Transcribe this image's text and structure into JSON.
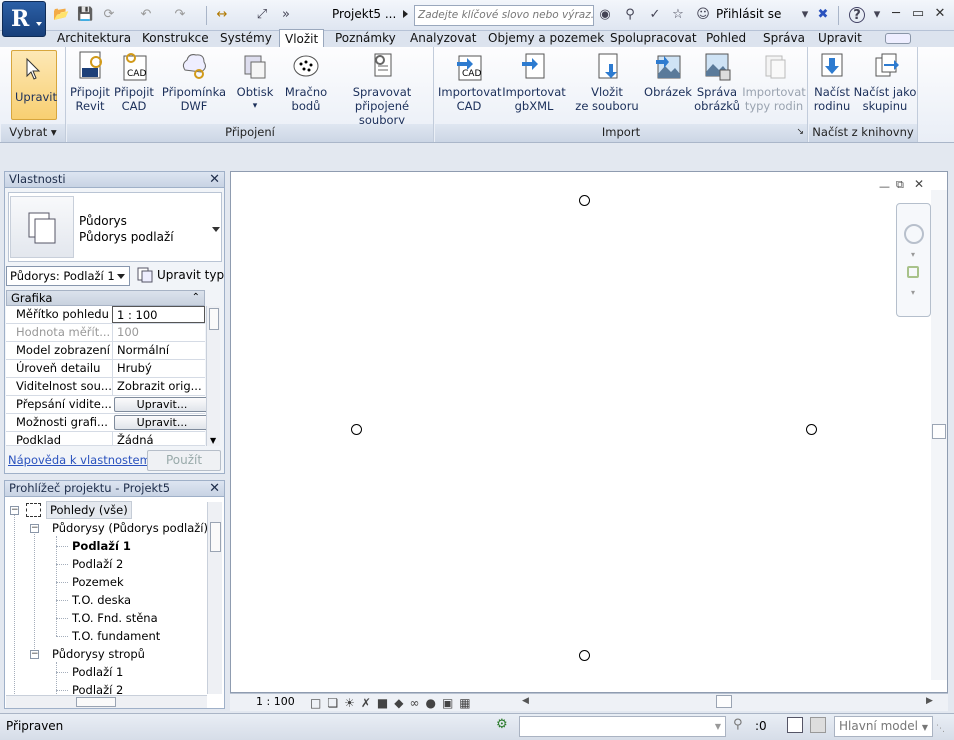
{
  "titlebar": {
    "app_logo": "R",
    "doc_title": "Projekt5 ...",
    "search_placeholder": "Zadejte klíčové slovo nebo výraz.",
    "sign_in": "Přihlásit se"
  },
  "tabs": [
    "Architektura",
    "Konstrukce",
    "Systémy",
    "Vložit",
    "Poznámky",
    "Analyzovat",
    "Objemy a pozemek",
    "Spolupracovat",
    "Pohled",
    "Správa",
    "Upravit"
  ],
  "active_tab": "Vložit",
  "ribbon": {
    "modify": {
      "label": "Upravit",
      "panel": "Vybrat"
    },
    "link_panel": {
      "label": "Připojení",
      "buttons": [
        {
          "line1": "Připojit",
          "line2": "Revit"
        },
        {
          "line1": "Připojit",
          "line2": "CAD"
        },
        {
          "line1": "Připomínka",
          "line2": "DWF"
        },
        {
          "line1": "Obtisk",
          "line2": ""
        },
        {
          "line1": "Mračno",
          "line2": "bodů"
        },
        {
          "line1": "Spravovat",
          "line2": "připojené soubory"
        }
      ]
    },
    "import_panel": {
      "label": "Import",
      "buttons": [
        {
          "line1": "Importovat",
          "line2": "CAD"
        },
        {
          "line1": "Importovat",
          "line2": "gbXML"
        },
        {
          "line1": "Vložit",
          "line2": "ze souboru"
        },
        {
          "line1": "Obrázek",
          "line2": ""
        },
        {
          "line1": "Správa",
          "line2": "obrázků"
        },
        {
          "line1": "Importovat",
          "line2": "typy rodin"
        }
      ]
    },
    "library_panel": {
      "label": "Načíst z knihovny",
      "buttons": [
        {
          "line1": "Načíst",
          "line2": "rodinu"
        },
        {
          "line1": "Načíst jako",
          "line2": "skupinu"
        }
      ]
    }
  },
  "properties": {
    "title": "Vlastnosti",
    "type_name_1": "Půdorys",
    "type_name_2": "Půdorys podlaží",
    "view_selector": "Půdorys: Podlaží 1",
    "edit_type": "Upravit typ",
    "group": "Grafika",
    "rows": [
      {
        "key": "Měřítko pohledu",
        "value": "1 : 100"
      },
      {
        "key": "Hodnota měřít...",
        "value": "100"
      },
      {
        "key": "Model zobrazení",
        "value": "Normální"
      },
      {
        "key": "Úroveň detailu",
        "value": "Hrubý"
      },
      {
        "key": "Viditelnost sou...",
        "value": "Zobrazit orig..."
      },
      {
        "key": "Přepsání vidite...",
        "value": "Upravit..."
      },
      {
        "key": "Možnosti grafi...",
        "value": "Upravit..."
      },
      {
        "key": "Podklad",
        "value": "Žádná"
      }
    ],
    "help_link": "Nápověda k vlastnostem",
    "apply": "Použít"
  },
  "browser": {
    "title": "Prohlížeč projektu - Projekt5",
    "root": "Pohledy (vše)",
    "group1": "Půdorysy (Půdorys podlaží)",
    "group1_items": [
      "Podlaží 1",
      "Podlaží 2",
      "Pozemek",
      "T.O. deska",
      "T.O. Fnd. stěna",
      "T.O. fundament"
    ],
    "group2": "Půdorysy stropů",
    "group2_items": [
      "Podlaží 1",
      "Podlaží 2"
    ]
  },
  "view": {
    "scale": "1 : 100"
  },
  "status": {
    "text": "Připraven",
    "selection_count": ":0",
    "model": "Hlavní model"
  }
}
